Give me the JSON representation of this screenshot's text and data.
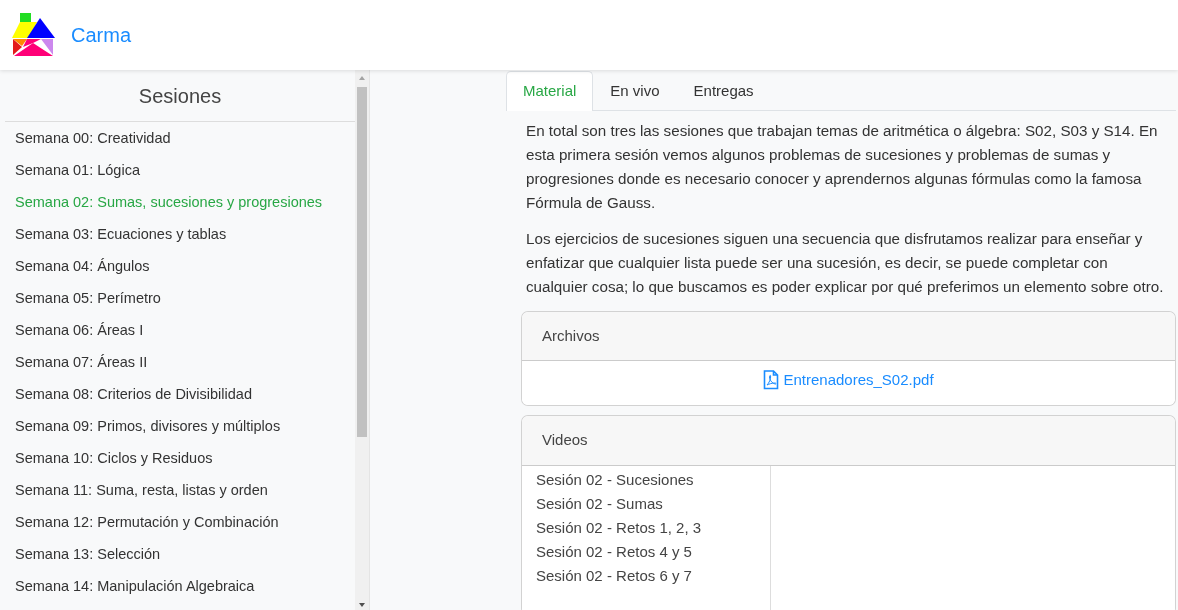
{
  "brand": {
    "name": "Carma"
  },
  "sidebar": {
    "title": "Sesiones",
    "items": [
      {
        "label": "Semana 00: Creatividad",
        "selected": false
      },
      {
        "label": "Semana 01: Lógica",
        "selected": false
      },
      {
        "label": "Semana 02: Sumas, sucesiones y progresiones",
        "selected": true
      },
      {
        "label": "Semana 03: Ecuaciones y tablas",
        "selected": false
      },
      {
        "label": "Semana 04: Ángulos",
        "selected": false
      },
      {
        "label": "Semana 05: Perímetro",
        "selected": false
      },
      {
        "label": "Semana 06: Áreas I",
        "selected": false
      },
      {
        "label": "Semana 07: Áreas II",
        "selected": false
      },
      {
        "label": "Semana 08: Criterios de Divisibilidad",
        "selected": false
      },
      {
        "label": "Semana 09: Primos, divisores y múltiplos",
        "selected": false
      },
      {
        "label": "Semana 10: Ciclos y Residuos",
        "selected": false
      },
      {
        "label": "Semana 11: Suma, resta, listas y orden",
        "selected": false
      },
      {
        "label": "Semana 12: Permutación y Combinación",
        "selected": false
      },
      {
        "label": "Semana 13: Selección",
        "selected": false
      },
      {
        "label": "Semana 14: Manipulación Algebraica",
        "selected": false
      }
    ]
  },
  "tabs": [
    {
      "label": "Material",
      "selected": true
    },
    {
      "label": "En vivo",
      "selected": false
    },
    {
      "label": "Entregas",
      "selected": false
    }
  ],
  "paragraphs": [
    "En total son tres las sesiones que trabajan temas de aritmética o álgebra: S02, S03 y S14. En esta primera sesión vemos algunos problemas de sucesiones y problemas de sumas y progresiones donde es necesario conocer y aprendernos algunas fórmulas como la famosa Fórmula de Gauss.",
    "Los ejercicios de sucesiones siguen una secuencia que disfrutamos realizar para enseñar y enfatizar que cualquier lista puede ser una sucesión, es decir, se puede completar con cualquier cosa; lo que buscamos es poder explicar por qué preferimos un elemento sobre otro."
  ],
  "files": {
    "title": "Archivos",
    "items": [
      "Entrenadores_S02.pdf"
    ]
  },
  "videos": {
    "title": "Videos",
    "items": [
      "Sesión 02 - Sucesiones",
      "Sesión 02 - Sumas",
      "Sesión 02 - Retos 1, 2, 3",
      "Sesión 02 - Retos 4 y 5",
      "Sesión 02 - Retos 6 y 7"
    ]
  }
}
